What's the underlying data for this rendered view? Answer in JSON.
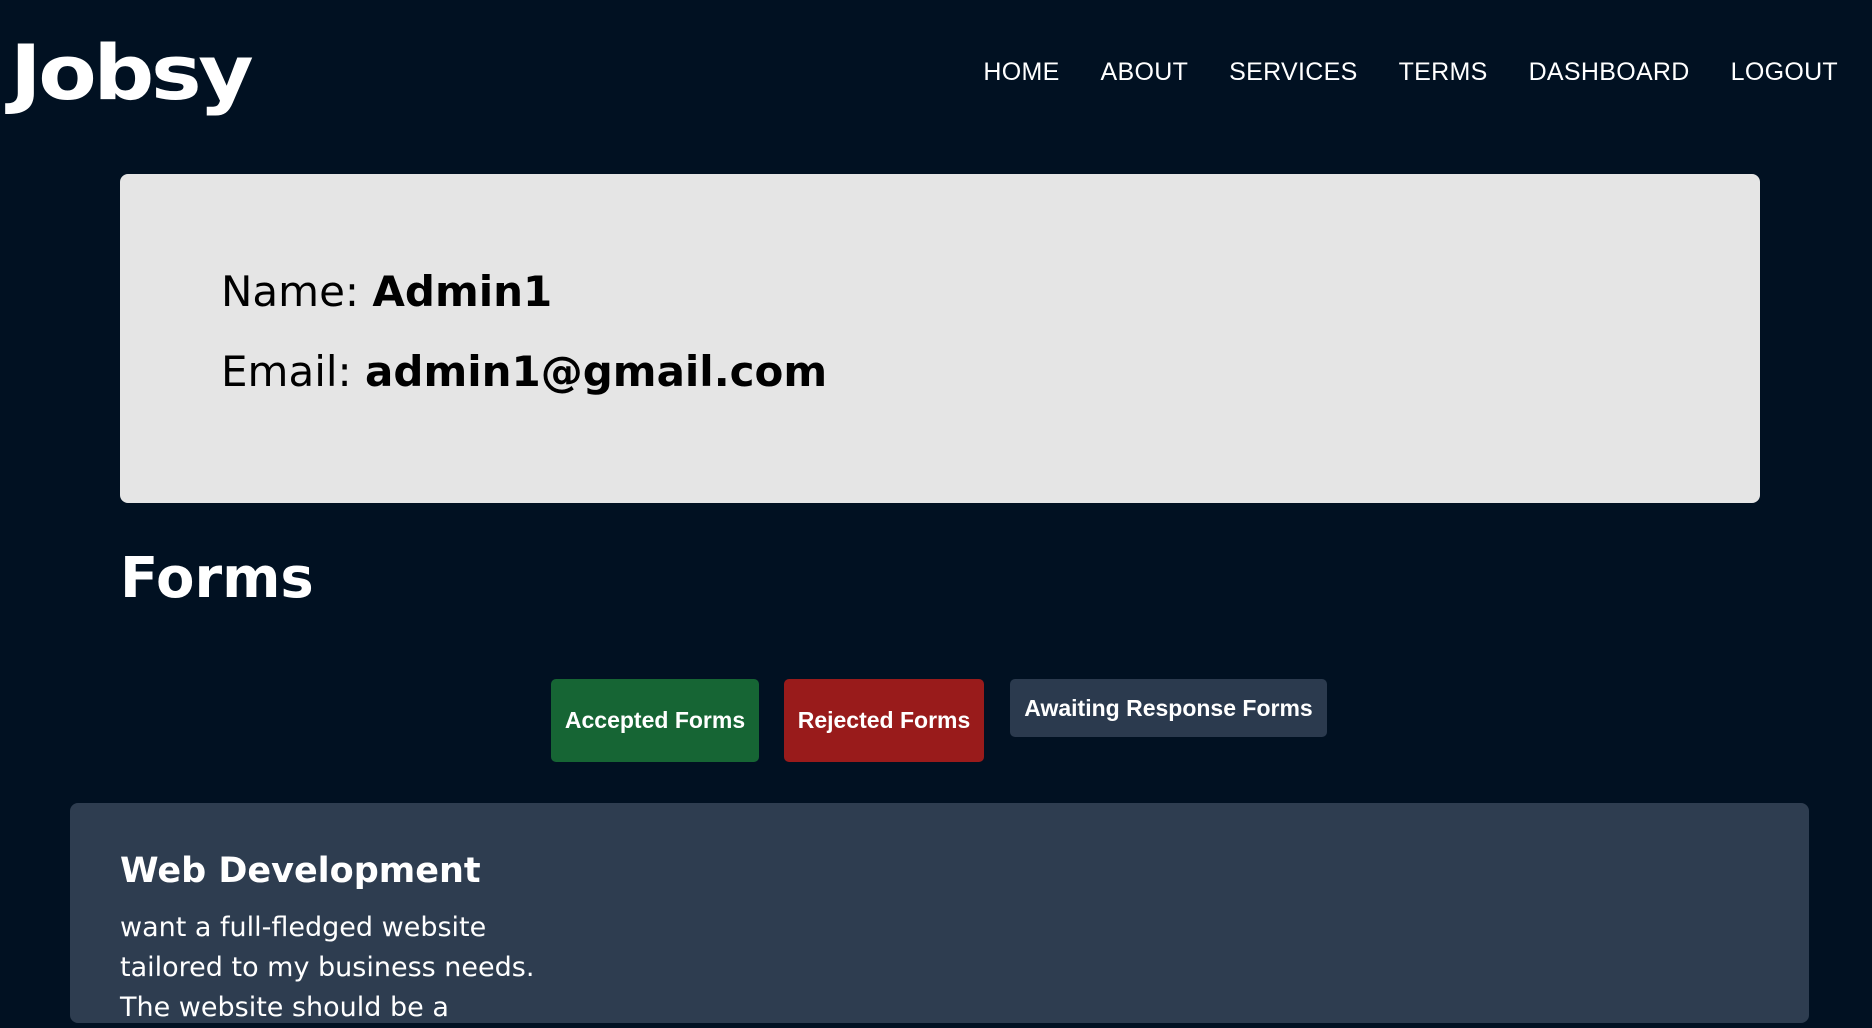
{
  "brand": {
    "logo": "Jobsy"
  },
  "nav": {
    "items": [
      {
        "label": "HOME"
      },
      {
        "label": "ABOUT"
      },
      {
        "label": "SERVICES"
      },
      {
        "label": "TERMS"
      },
      {
        "label": "DASHBOARD"
      },
      {
        "label": "LOGOUT"
      }
    ]
  },
  "profile": {
    "name_label": "Name:",
    "name_value": "Admin1",
    "email_label": "Email:",
    "email_value": "admin1@gmail.com"
  },
  "forms": {
    "heading": "Forms",
    "filters": {
      "accepted": "Accepted Forms",
      "rejected": "Rejected Forms",
      "awaiting": "Awaiting Response Forms"
    },
    "items": [
      {
        "title": "Web Development",
        "description": "want a full-fledged website tailored to my business needs. The website should be a"
      }
    ]
  },
  "colors": {
    "background": "#011122",
    "profile_card": "#e5e5e5",
    "accepted": "#166534",
    "rejected": "#991b1b",
    "awaiting": "#2b3a4e",
    "form_card": "#2e3d50"
  }
}
